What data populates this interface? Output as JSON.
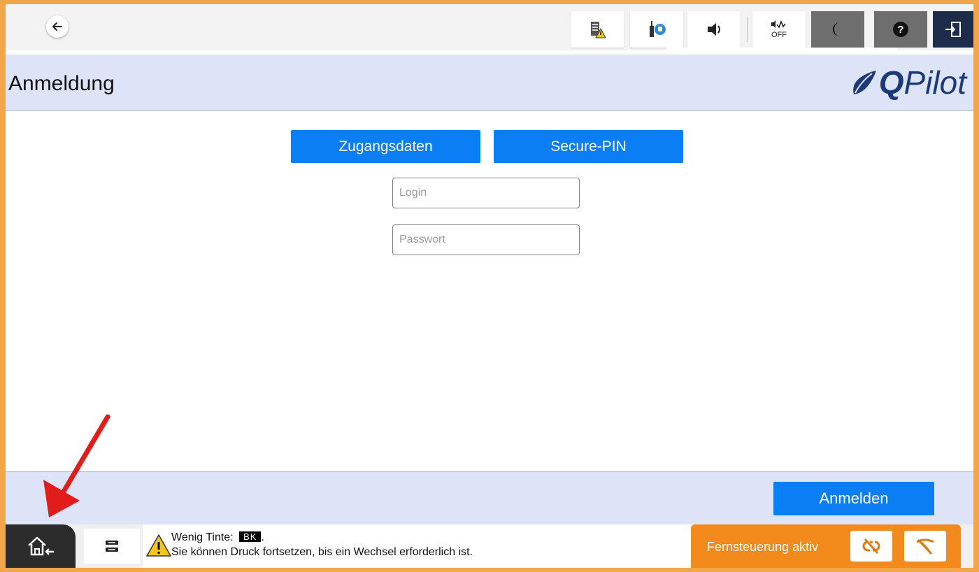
{
  "topbar": {
    "status_icons": [
      {
        "name": "device-warning-icon"
      },
      {
        "name": "network-status-icon"
      },
      {
        "name": "speaker-icon"
      },
      {
        "name": "sound-off-icon",
        "label": "OFF"
      },
      {
        "name": "sleep-mode-icon"
      },
      {
        "name": "help-icon"
      },
      {
        "name": "logout-icon"
      }
    ]
  },
  "header": {
    "title": "Anmeldung",
    "logo": {
      "q": "Q",
      "rest": "Pilot"
    }
  },
  "login": {
    "tabs": [
      {
        "label": "Zugangsdaten"
      },
      {
        "label": "Secure-PIN"
      }
    ],
    "login_placeholder": "Login",
    "password_placeholder": "Passwort",
    "submit_label": "Anmelden"
  },
  "status": {
    "line1_prefix": "Wenig Tinte:",
    "ink_badge": "BK",
    "line1_suffix": ".",
    "line2": "Sie können Druck fortsetzen, bis ein Wechsel erforderlich ist."
  },
  "remote": {
    "label": "Fernsteuerung aktiv"
  },
  "colors": {
    "accent_blue": "#0a7ef5",
    "remote_orange": "#f28a1c",
    "header_bg": "#dde4f8",
    "frame_orange": "#f2a64a",
    "annotation_red": "#e21b1b"
  }
}
